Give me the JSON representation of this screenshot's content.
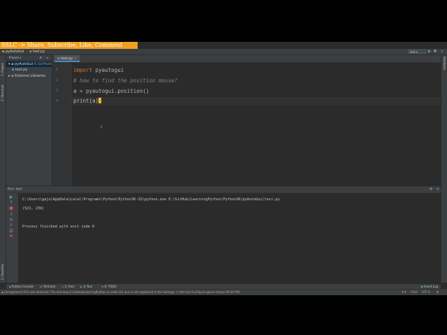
{
  "banner": "SSLC -> Share, Subscribe, Like, Comment",
  "navbar": {
    "crumbs": [
      "pyAutoGui",
      "test.py"
    ],
    "run_config": "test"
  },
  "project_panel": {
    "header": "Project",
    "root": "pyAutoGui",
    "root_path": "E:\\GitHub\\...",
    "file": "test.py",
    "external": "External Libraries"
  },
  "left_tabs": [
    "1: Project",
    "2: Structure",
    "2: Favorites"
  ],
  "right_tabs": [
    "Database"
  ],
  "editor": {
    "tab": "test.py",
    "line_numbers": [
      "1",
      "2",
      "3",
      "4"
    ],
    "lines": [
      {
        "kw": "import",
        "rest": " pyautogui"
      },
      {
        "comment": "# how to find the position mouse?"
      },
      {
        "var": "a",
        "rest": " = pyautogui.position()"
      },
      {
        "fn": "print",
        "open": "(",
        "arg": "a",
        "close": ")"
      }
    ]
  },
  "run_panel": {
    "header": "Run: ",
    "config": "test",
    "lines": [
      "C:\\Users\\gaju\\AppData\\Local\\Programs\\Python\\Python36-32\\python.exe E:/GitHub/LearningPython/Python36/pyAutoGui/test.py",
      "(521, 239)",
      "",
      "Process finished with exit code 0"
    ]
  },
  "bottom_tabs": {
    "python_console": "Python Console",
    "terminal": "Terminal",
    "find": "3: Find",
    "run": "4: Run",
    "todo": "6: TODO",
    "event_log": "Event Log"
  },
  "status": {
    "message": "Unregistered VCS root detected: The directory E:\\GitHub\\LearningPython is under Git, but is not registered in the Settings. // Add root  Configure  Ignore (today 09:29 PM)",
    "position": "4:9",
    "line_sep": "CRLF",
    "encoding": "UTF-8"
  },
  "colors": {
    "banner_bg": "#f0a020",
    "ide_bg": "#2b2b2b",
    "keyword": "#cc7832",
    "comment": "#808080",
    "caret": "#e8b830"
  }
}
